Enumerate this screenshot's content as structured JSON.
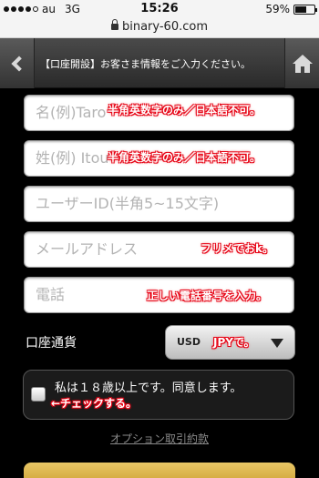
{
  "status_bar": {
    "carrier": "au",
    "network": "3G",
    "time": "15:26",
    "battery": "59%",
    "battery_level": 0.59
  },
  "url_bar": {
    "url": "binary-60.com"
  },
  "header": {
    "title": "【口座開設】お客さま情報をご入力ください。"
  },
  "form": {
    "first_name_placeholder": "名(例)Taro",
    "last_name_placeholder": "姓(例) Itou",
    "userid_placeholder": "ユーザーID(半角5~15文字)",
    "email_placeholder": "メールアドレス",
    "phone_placeholder": "電話",
    "currency_label": "口座通貨",
    "currency_value": "USD",
    "agree_text": "私は１８歳以上です。同意します。",
    "terms_link": "オプション取引約款"
  },
  "annotations": {
    "first_name_note": "半角英数字のみ／日本語不可。",
    "last_name_note": "半角英数字のみ／日本語不可。",
    "email_note": "フリメでおk。",
    "phone_note": "正しい電話番号を入力。",
    "currency_note": "JPYで。",
    "checkbox_note": "←チェックする。"
  },
  "colors": {
    "annotation": "#e60012",
    "button": "#d9ae45"
  }
}
